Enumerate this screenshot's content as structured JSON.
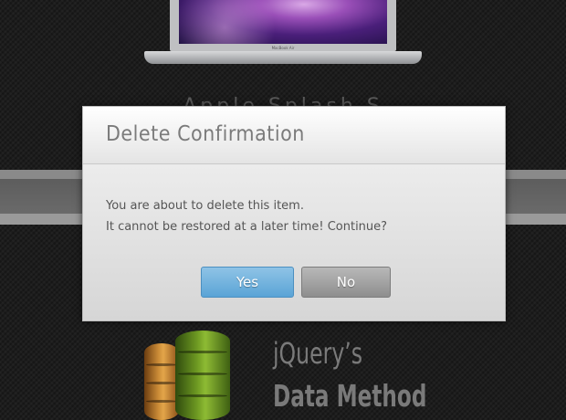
{
  "dialog": {
    "title": "Delete Confirmation",
    "message_line1": "You are about to delete this item.",
    "message_line2": "It cannot be restored at a later time! Continue?",
    "yes_label": "Yes",
    "no_label": "No"
  },
  "background": {
    "laptop_brand": "MacBook Air",
    "obscured_title": "Apple Splash S",
    "heading_line1": "jQuery’s",
    "heading_line2": "Data Method",
    "icon": "database-icon"
  },
  "colors": {
    "yes_button": "#6fb1dd",
    "no_button": "#a3a3a3",
    "dialog_bg": "#dcdcdc",
    "page_bg": "#1d1d1d"
  }
}
